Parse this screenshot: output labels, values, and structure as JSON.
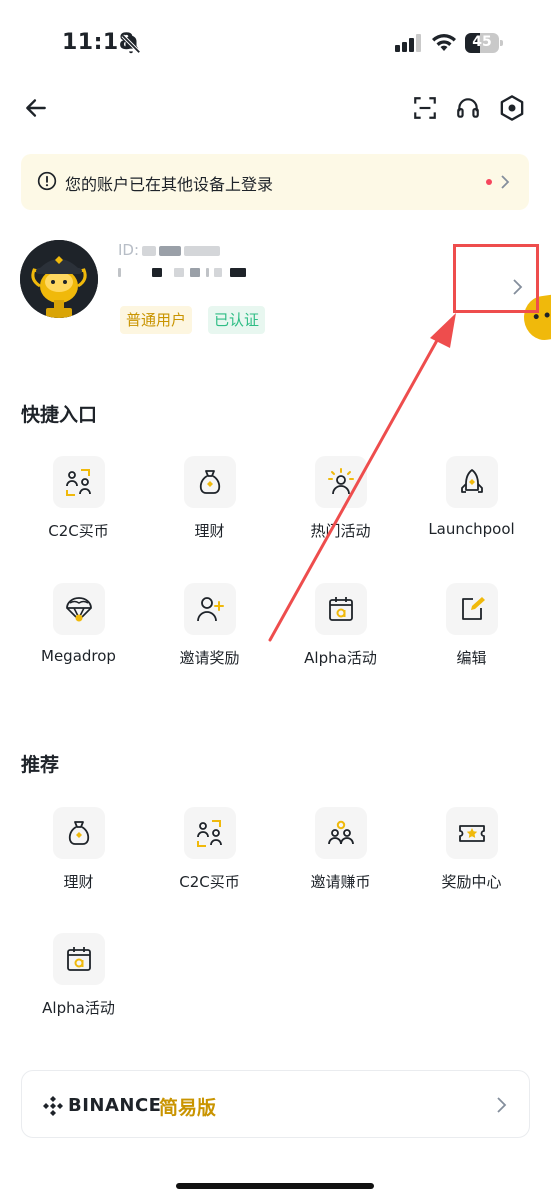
{
  "status_bar": {
    "time": "11:18",
    "battery": "45",
    "battery_level": 0.45
  },
  "nav": {
    "back": "back-arrow-icon",
    "scan": "scan-icon",
    "support": "headset-icon",
    "settings": "settings-hexagon-icon"
  },
  "notice": {
    "text": "您的账户已在其他设备上登录",
    "dot_color": "#f6465d"
  },
  "profile": {
    "id_label": "ID:",
    "tags": [
      "普通用户",
      "已认证"
    ]
  },
  "shortcuts": {
    "title": "快捷入口",
    "items": [
      {
        "label": "C2C买币",
        "icon": "c2c-icon"
      },
      {
        "label": "理财",
        "icon": "money-bag-icon"
      },
      {
        "label": "热门活动",
        "icon": "hot-activity-icon"
      },
      {
        "label": "Launchpool",
        "icon": "rocket-icon"
      },
      {
        "label": "Megadrop",
        "icon": "parachute-icon"
      },
      {
        "label": "邀请奖励",
        "icon": "invite-user-icon"
      },
      {
        "label": "Alpha活动",
        "icon": "alpha-calendar-icon"
      },
      {
        "label": "编辑",
        "icon": "edit-icon"
      }
    ]
  },
  "recommended": {
    "title": "推荐",
    "items": [
      {
        "label": "理财",
        "icon": "money-bag-icon"
      },
      {
        "label": "C2C买币",
        "icon": "c2c-icon"
      },
      {
        "label": "邀请赚币",
        "icon": "invite-earn-icon"
      },
      {
        "label": "奖励中心",
        "icon": "reward-ticket-icon"
      },
      {
        "label": "Alpha活动",
        "icon": "alpha-calendar-icon"
      }
    ]
  },
  "lite": {
    "brand": "BINANCE",
    "subtitle": "简易版"
  },
  "colors": {
    "accent": "#f0b90b",
    "accent_text": "#c99400",
    "verified": "#2ebd85",
    "annotation": "#ee4d4d"
  }
}
